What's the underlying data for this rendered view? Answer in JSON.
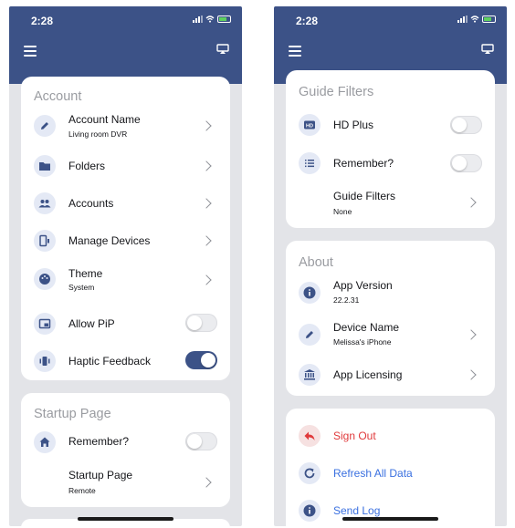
{
  "left": {
    "status": {
      "time": "2:28"
    },
    "account": {
      "title": "Account",
      "items": [
        {
          "label": "Account Name",
          "sub": "Living room DVR",
          "icon": "pencil-icon"
        },
        {
          "label": "Folders",
          "icon": "folder-icon"
        },
        {
          "label": "Accounts",
          "icon": "people-icon"
        },
        {
          "label": "Manage Devices",
          "icon": "devices-icon"
        },
        {
          "label": "Theme",
          "sub": "System",
          "icon": "palette-icon"
        },
        {
          "label": "Allow PiP",
          "icon": "pip-icon",
          "toggle": false
        },
        {
          "label": "Haptic Feedback",
          "icon": "vibration-icon",
          "toggle": true
        }
      ]
    },
    "startup": {
      "title": "Startup Page",
      "items": [
        {
          "label": "Remember?",
          "icon": "home-icon",
          "toggle": false
        },
        {
          "label": "Startup Page",
          "sub": "Remote"
        }
      ]
    }
  },
  "right": {
    "status": {
      "time": "2:28"
    },
    "guide": {
      "title": "Guide Filters",
      "items": [
        {
          "label": "HD Plus",
          "icon": "hd-icon",
          "toggle": false
        },
        {
          "label": "Remember?",
          "icon": "list-icon",
          "toggle": false
        },
        {
          "label": "Guide Filters",
          "sub": "None"
        }
      ]
    },
    "about": {
      "title": "About",
      "items": [
        {
          "label": "App Version",
          "sub": "22.2.31",
          "icon": "info-icon"
        },
        {
          "label": "Device Name",
          "sub": "Melissa's iPhone",
          "icon": "pencil-icon"
        },
        {
          "label": "App Licensing",
          "icon": "bank-icon"
        }
      ]
    },
    "actions": {
      "items": [
        {
          "label": "Sign Out",
          "icon": "reply-icon"
        },
        {
          "label": "Refresh All Data",
          "icon": "refresh-icon"
        },
        {
          "label": "Send Log",
          "icon": "info-icon"
        }
      ]
    }
  },
  "colors": {
    "header": "#3c5287",
    "accent": "#3c5287",
    "danger": "#e0393b",
    "link": "#3a70e0",
    "background": "#e3e4e8"
  }
}
